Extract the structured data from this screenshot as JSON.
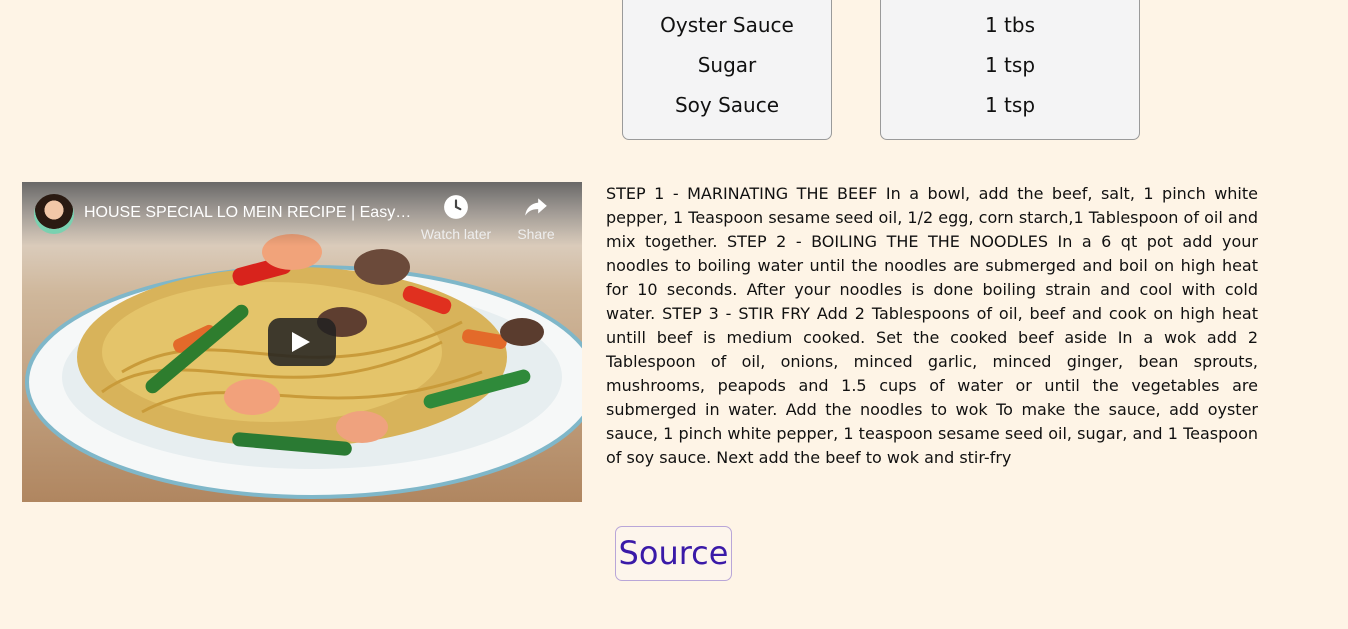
{
  "ingredients": [
    {
      "name": "Oyster Sauce",
      "quantity": "1 tbs"
    },
    {
      "name": "Sugar",
      "quantity": "1 tsp"
    },
    {
      "name": "Soy Sauce",
      "quantity": "1 tsp"
    }
  ],
  "video": {
    "title": "HOUSE SPECIAL LO MEIN RECIPE | Easy Chinese Lo Mein",
    "watch_later_label": "Watch later",
    "share_label": "Share",
    "icons": {
      "watch_later": "clock-icon",
      "share": "share-arrow-icon",
      "play": "play-icon"
    }
  },
  "instructions": "STEP 1 - MARINATING THE BEEF In a bowl, add the beef, salt, 1 pinch white pepper, 1 Teaspoon sesame seed oil, 1/2 egg, corn starch,1 Tablespoon of oil and mix together. STEP 2 - BOILING THE THE NOODLES In a 6 qt pot add your noodles to boiling water until the noodles are submerged and boil on high heat for 10 seconds. After your noodles is done boiling strain and cool with cold water. STEP 3 - STIR FRY Add 2 Tablespoons of oil, beef and cook on high heat untill beef is medium cooked. Set the cooked beef aside In a wok add 2 Tablespoon of oil, onions, minced garlic, minced ginger, bean sprouts, mushrooms, peapods and 1.5 cups of water or until the vegetables are submerged in water. Add the noodles to wok To make the sauce, add oyster sauce, 1 pinch white pepper, 1 teaspoon sesame seed oil, sugar, and 1 Teaspoon of soy sauce. Next add the beef to wok and stir-fry",
  "source_label": "Source",
  "colors": {
    "background": "#fef4e6",
    "link": "#3a1aa8",
    "box": "#f4f4f5"
  }
}
